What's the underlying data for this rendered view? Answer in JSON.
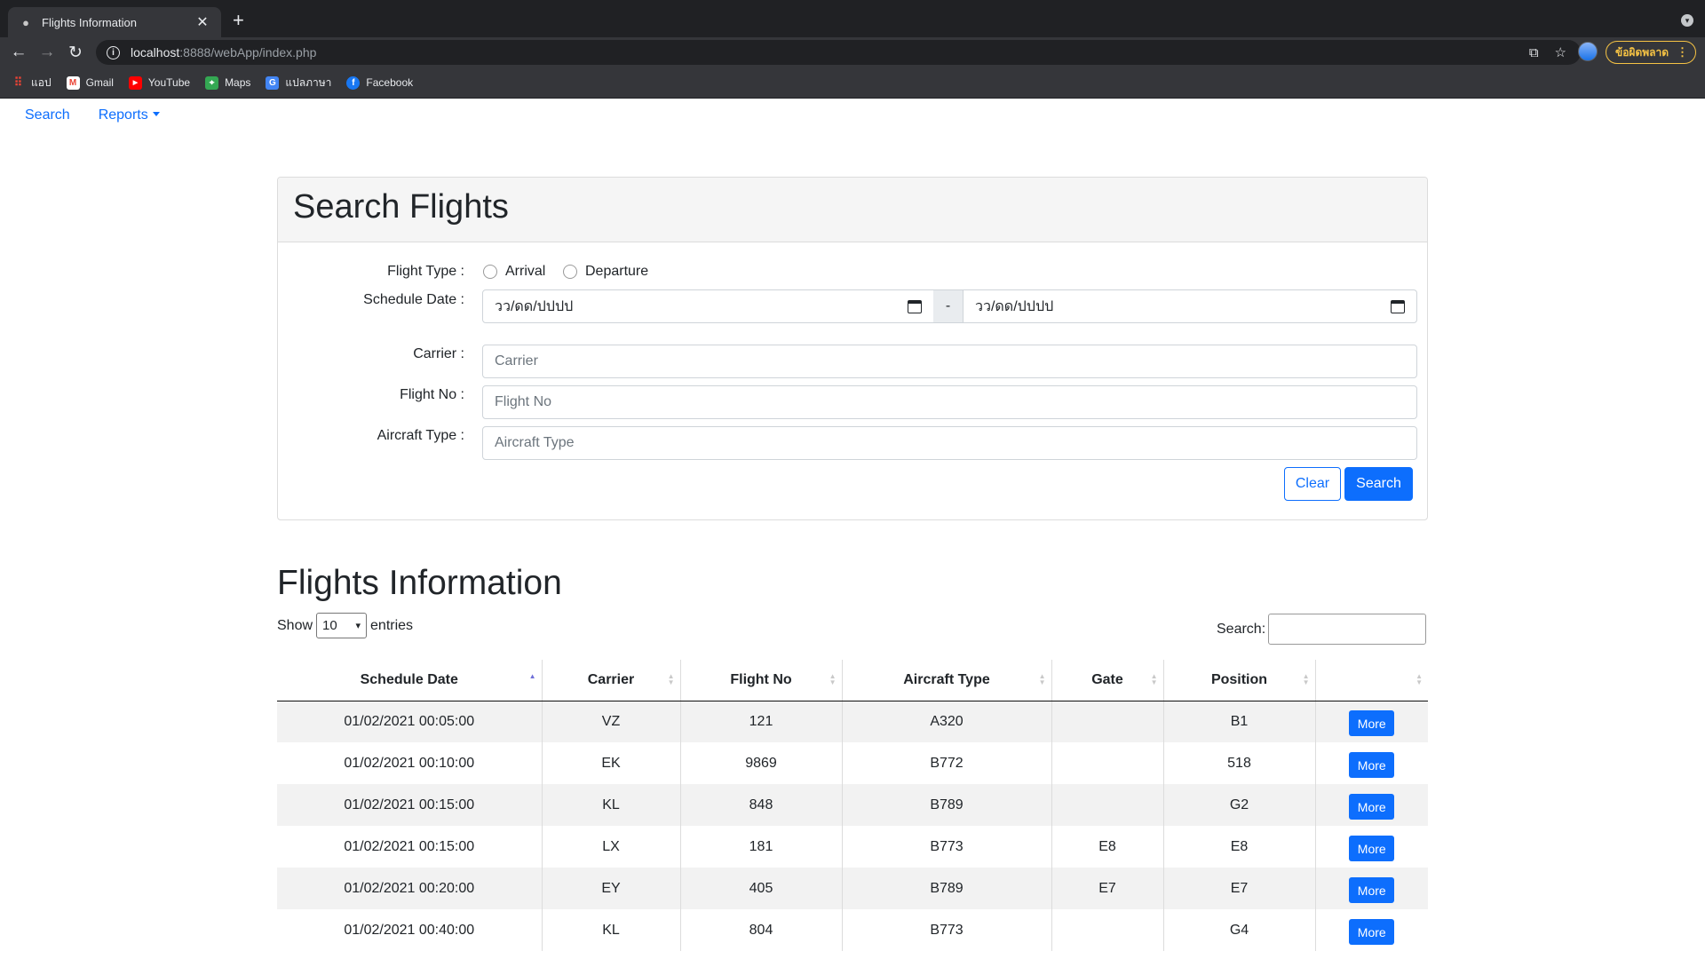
{
  "browser": {
    "tab_title": "Flights Information",
    "tab_close": "✕",
    "new_tab": "+",
    "url_host": "localhost",
    "url_rest": ":8888/webApp/index.php",
    "error_badge": "ข้อผิดพลาด",
    "bookmarks": [
      {
        "label": "แอป",
        "icon": "apps-grid-icon"
      },
      {
        "label": "Gmail",
        "icon": "gmail-icon"
      },
      {
        "label": "YouTube",
        "icon": "youtube-icon"
      },
      {
        "label": "Maps",
        "icon": "maps-icon"
      },
      {
        "label": "แปลภาษา",
        "icon": "translate-icon"
      },
      {
        "label": "Facebook",
        "icon": "facebook-icon"
      }
    ]
  },
  "nav": {
    "search": "Search",
    "reports": "Reports"
  },
  "search_card": {
    "title": "Search Flights",
    "flight_type_label": "Flight Type :",
    "arrival": "Arrival",
    "departure": "Departure",
    "schedule_date_label": "Schedule Date :",
    "date_from": "วว/ดด/ปปปป",
    "date_separator": "-",
    "date_to": "วว/ดด/ปปปป",
    "carrier_label": "Carrier :",
    "carrier_placeholder": "Carrier",
    "flight_no_label": "Flight No :",
    "flight_no_placeholder": "Flight No",
    "aircraft_type_label": "Aircraft Type :",
    "aircraft_type_placeholder": "Aircraft Type",
    "clear_button": "Clear",
    "search_button": "Search"
  },
  "flights": {
    "title": "Flights Information",
    "show": "Show",
    "page_size": "10",
    "entries": "entries",
    "search_label": "Search:",
    "columns": [
      "Schedule Date",
      "Carrier",
      "Flight No",
      "Aircraft Type",
      "Gate",
      "Position",
      ""
    ],
    "more_label": "More",
    "rows": [
      {
        "date": "01/02/2021 00:05:00",
        "carrier": "VZ",
        "flight_no": "121",
        "aircraft": "A320",
        "gate": "",
        "position": "B1"
      },
      {
        "date": "01/02/2021 00:10:00",
        "carrier": "EK",
        "flight_no": "9869",
        "aircraft": "B772",
        "gate": "",
        "position": "518"
      },
      {
        "date": "01/02/2021 00:15:00",
        "carrier": "KL",
        "flight_no": "848",
        "aircraft": "B789",
        "gate": "",
        "position": "G2"
      },
      {
        "date": "01/02/2021 00:15:00",
        "carrier": "LX",
        "flight_no": "181",
        "aircraft": "B773",
        "gate": "E8",
        "position": "E8"
      },
      {
        "date": "01/02/2021 00:20:00",
        "carrier": "EY",
        "flight_no": "405",
        "aircraft": "B789",
        "gate": "E7",
        "position": "E7"
      },
      {
        "date": "01/02/2021 00:40:00",
        "carrier": "KL",
        "flight_no": "804",
        "aircraft": "B773",
        "gate": "",
        "position": "G4"
      }
    ]
  },
  "colors": {
    "primary": "#0d6efd",
    "chrome_dark": "#202124",
    "chrome_toolbar": "#35363a",
    "error_badge": "#f6c344"
  }
}
